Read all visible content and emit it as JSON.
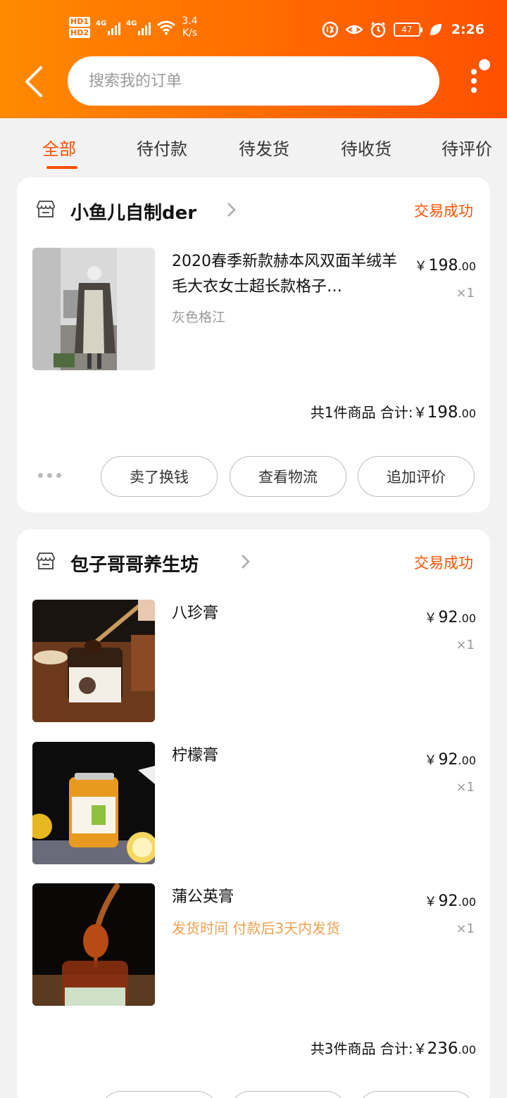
{
  "status_bar": {
    "hd1": "HD1",
    "hd2": "HD2",
    "net1": "4G",
    "net2": "4G",
    "speed_value": "3.4",
    "speed_unit": "K/s",
    "battery": "47",
    "time": "2:26"
  },
  "search": {
    "placeholder": "搜索我的订单"
  },
  "tabs": [
    {
      "label": "全部",
      "active": true
    },
    {
      "label": "待付款"
    },
    {
      "label": "待发货"
    },
    {
      "label": "待收货"
    },
    {
      "label": "待评价"
    }
  ],
  "orders": [
    {
      "shop_name": "小鱼儿自制der",
      "status": "交易成功",
      "items": [
        {
          "title": "2020春季新款赫本风双面羊绒羊毛大衣女士超长款格子…",
          "sku": "灰色格江",
          "currency": "￥",
          "price_int": "198",
          "price_dec": ".00",
          "qty": "×1"
        }
      ],
      "summary_count": "共1件商品 合计:",
      "summary_currency": "￥",
      "summary_int": "198",
      "summary_dec": ".00",
      "buttons": [
        "卖了换钱",
        "查看物流",
        "追加评价"
      ]
    },
    {
      "shop_name": "包子哥哥养生坊",
      "status": "交易成功",
      "items": [
        {
          "title": "八珍膏",
          "currency": "￥",
          "price_int": "92",
          "price_dec": ".00",
          "qty": "×1"
        },
        {
          "title": "柠檬膏",
          "currency": "￥",
          "price_int": "92",
          "price_dec": ".00",
          "qty": "×1"
        },
        {
          "title": "蒲公英膏",
          "note": "发货时间 付款后3天内发货",
          "currency": "￥",
          "price_int": "92",
          "price_dec": ".00",
          "qty": "×1"
        }
      ],
      "summary_count": "共3件商品 合计:",
      "summary_currency": "￥",
      "summary_int": "236",
      "summary_dec": ".00"
    }
  ],
  "colors": {
    "accent": "#ff5000",
    "header_start": "#ff8a00",
    "header_end": "#ff5000",
    "note": "#f0a050"
  }
}
